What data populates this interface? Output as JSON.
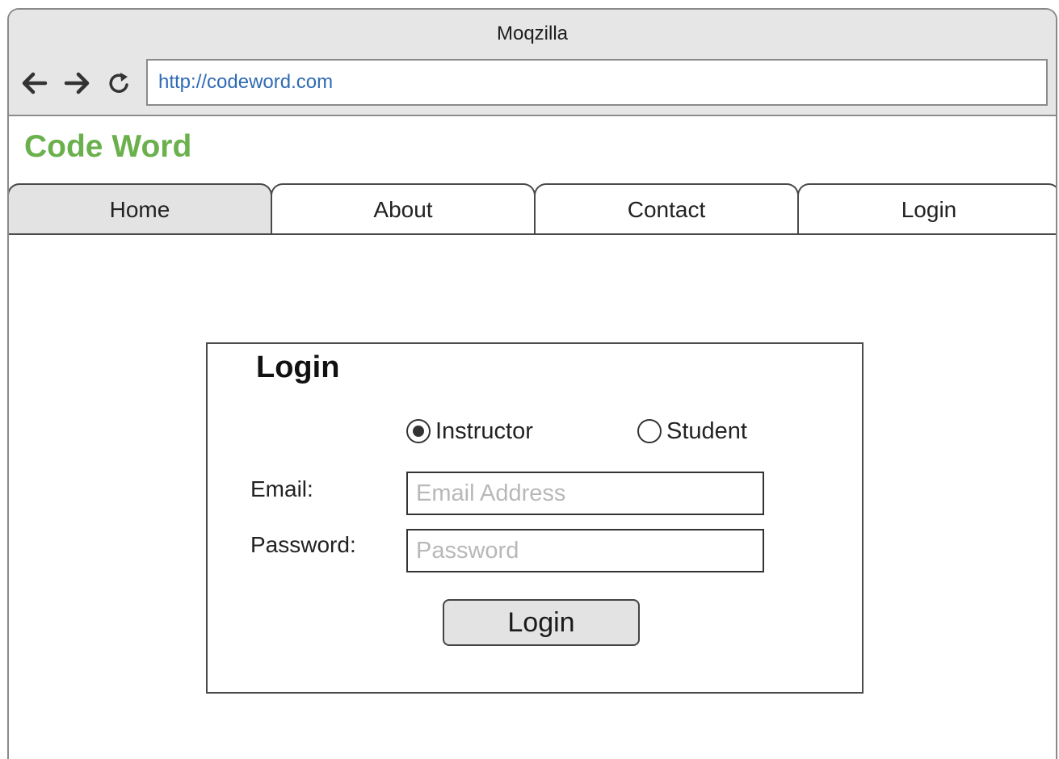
{
  "window": {
    "title": "Moqzilla"
  },
  "toolbar": {
    "back_icon": "arrow-left-icon",
    "forward_icon": "arrow-right-icon",
    "reload_icon": "reload-icon",
    "url": "http://codeword.com"
  },
  "site": {
    "brand": "Code Word",
    "brand_color": "#6ab04c"
  },
  "nav": {
    "tabs": [
      {
        "label": "Home",
        "active": true
      },
      {
        "label": "About",
        "active": false
      },
      {
        "label": "Contact",
        "active": false
      },
      {
        "label": "Login",
        "active": false
      }
    ]
  },
  "login_form": {
    "title": "Login",
    "roles": [
      {
        "label": "Instructor",
        "selected": true
      },
      {
        "label": "Student",
        "selected": false
      }
    ],
    "email": {
      "label": "Email:",
      "placeholder": "Email Address",
      "value": ""
    },
    "password": {
      "label": "Password:",
      "placeholder": "Password",
      "value": ""
    },
    "submit_label": "Login"
  },
  "colors": {
    "url_text": "#2f6bb5",
    "chrome_bg": "#e6e6e6",
    "active_tab_bg": "#e3e3e3"
  }
}
